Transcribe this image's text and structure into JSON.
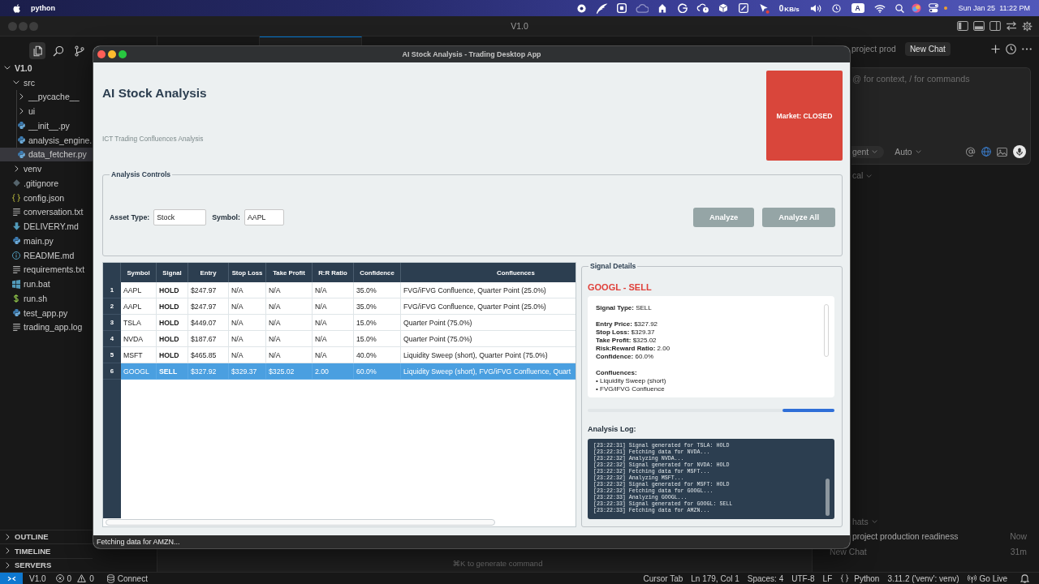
{
  "menu_bar": {
    "app_name": "python",
    "network_speed": "0",
    "network_unit": "KB/s",
    "input_source": "A",
    "date": "Sun Jan 25",
    "time": "11:22 PM"
  },
  "ide": {
    "title": "V1.0",
    "activity_bar": [
      {
        "selected": true
      },
      {
        "selected": false
      },
      {
        "selected": false
      }
    ],
    "editor_tabs": [
      {
        "selected": false
      },
      {
        "selected": true
      }
    ],
    "explorer": {
      "name": "V1.0",
      "expanded": true,
      "children": [
        {
          "name": "src",
          "kind": "folder",
          "expanded": true,
          "selected": false,
          "children": [
            {
              "name": "__pycache__",
              "kind": "folder",
              "expanded": false,
              "selected": false
            },
            {
              "name": "ui",
              "kind": "folder",
              "expanded": false,
              "selected": false
            },
            {
              "name": "__init__.py",
              "kind": "python",
              "selected": false
            },
            {
              "name": "analysis_engine.",
              "kind": "python",
              "selected": false
            },
            {
              "name": "data_fetcher.py",
              "kind": "python",
              "selected": true
            }
          ]
        },
        {
          "name": "venv",
          "kind": "folder",
          "expanded": false,
          "selected": false
        },
        {
          "name": ".gitignore",
          "kind": "git",
          "selected": false
        },
        {
          "name": "config.json",
          "kind": "json",
          "selected": false
        },
        {
          "name": "conversation.txt",
          "kind": "text",
          "selected": false
        },
        {
          "name": "DELIVERY.md",
          "kind": "download",
          "selected": false
        },
        {
          "name": "main.py",
          "kind": "python",
          "selected": false
        },
        {
          "name": "README.md",
          "kind": "info",
          "selected": false
        },
        {
          "name": "requirements.txt",
          "kind": "text",
          "selected": false
        },
        {
          "name": "run.bat",
          "kind": "windows",
          "selected": false
        },
        {
          "name": "run.sh",
          "kind": "shell",
          "selected": false
        },
        {
          "name": "test_app.py",
          "kind": "python",
          "selected": false
        },
        {
          "name": "trading_app.log",
          "kind": "text",
          "selected": false
        }
      ]
    },
    "panels": [
      {
        "label": "OUTLINE",
        "expanded": false
      },
      {
        "label": "TIMELINE",
        "expanded": false
      },
      {
        "label": "SERVERS",
        "expanded": false
      }
    ],
    "editor_hint": "⌘K to generate command",
    "chat": {
      "tabs": [
        {
          "label": "project prod",
          "selected": false
        },
        {
          "label": "New Chat",
          "selected": true
        }
      ],
      "input_placeholder": "@ for context, / for commands",
      "composer_selectors": [
        "gent",
        "Auto"
      ],
      "dropdown": "cal",
      "history_heading": "hats",
      "history": [
        {
          "title": "project production readiness",
          "time": "Now"
        },
        {
          "title": "New Chat",
          "time": "31m"
        }
      ]
    },
    "status_bar": {
      "folder": "V1.0",
      "errors": "0",
      "warnings": "0",
      "connection": "Connect",
      "items": [
        {
          "label": "Cursor Tab",
          "kind": "plain"
        },
        {
          "label": "Ln 179, Col 1",
          "kind": "plain"
        },
        {
          "label": "Spaces: 4",
          "kind": "plain"
        },
        {
          "label": "UTF-8",
          "kind": "plain"
        },
        {
          "label": "LF",
          "kind": "plain"
        },
        {
          "label": "Python",
          "kind": "language"
        },
        {
          "label": "3.11.2 ('venv': venv)",
          "kind": "plain"
        },
        {
          "label": "Go Live",
          "kind": "live"
        }
      ]
    }
  },
  "app": {
    "title": "AI Stock Analysis - Trading Desktop App",
    "header": {
      "title": "AI Stock Analysis",
      "subtitle": "ICT Trading Confluences Analysis",
      "market": {
        "label": "Market: CLOSED",
        "open": false
      }
    },
    "controls": {
      "title": "Analysis Controls",
      "fields": [
        {
          "label": "Asset Type:",
          "value": "Stock"
        },
        {
          "label": "Symbol:",
          "value": "AAPL"
        }
      ],
      "buttons": [
        {
          "label": "Analyze",
          "disabled": true
        },
        {
          "label": "Analyze All",
          "disabled": true
        }
      ]
    },
    "table": {
      "columns": [
        "Symbol",
        "Signal",
        "Entry",
        "Stop Loss",
        "Take Profit",
        "R:R Ratio",
        "Confidence",
        "Confluences"
      ],
      "rows": [
        {
          "number": "1",
          "cells": [
            "AAPL",
            "HOLD",
            "$247.97",
            "N/A",
            "N/A",
            "N/A",
            "35.0%",
            "FVG/iFVG Confluence, Quarter Point (25.0%)"
          ],
          "selected": false
        },
        {
          "number": "2",
          "cells": [
            "AAPL",
            "HOLD",
            "$247.97",
            "N/A",
            "N/A",
            "N/A",
            "35.0%",
            "FVG/iFVG Confluence, Quarter Point (25.0%)"
          ],
          "selected": false
        },
        {
          "number": "3",
          "cells": [
            "TSLA",
            "HOLD",
            "$449.07",
            "N/A",
            "N/A",
            "N/A",
            "15.0%",
            "Quarter Point (75.0%)"
          ],
          "selected": false
        },
        {
          "number": "4",
          "cells": [
            "NVDA",
            "HOLD",
            "$187.67",
            "N/A",
            "N/A",
            "N/A",
            "15.0%",
            "Quarter Point (75.0%)"
          ],
          "selected": false
        },
        {
          "number": "5",
          "cells": [
            "MSFT",
            "HOLD",
            "$465.85",
            "N/A",
            "N/A",
            "N/A",
            "40.0%",
            "Liquidity Sweep (short), Quarter Point (75.0%)"
          ],
          "selected": false
        },
        {
          "number": "6",
          "cells": [
            "GOOGL",
            "SELL",
            "$327.92",
            "$329.37",
            "$325.02",
            "2.00",
            "60.0%",
            "Liquidity Sweep (short), FVG/iFVG Confluence, Quart"
          ],
          "selected": true
        }
      ]
    },
    "details": {
      "title": "Signal Details",
      "heading": "GOOGL - SELL",
      "kind": "sell",
      "sections": [
        {
          "lines": [
            "**Signal Type:** SELL"
          ]
        },
        {
          "lines": [
            "**Entry Price:** $327.92",
            "**Stop Loss:** $329.37",
            "**Take Profit:** $325.02",
            "**Risk:Reward Ratio:** 2.00",
            "**Confidence:** 60.0%"
          ]
        },
        {
          "heading": "Confluences:",
          "lines": [
            "• Liquidity Sweep (short)",
            "• FVG/iFVG Confluence"
          ]
        }
      ],
      "busy": true,
      "log_title": "Analysis Log:",
      "log": [
        "[23:22:31] Signal generated for TSLA: HOLD",
        "[23:22:31] Fetching data for NVDA...",
        "[23:22:32] Analyzing NVDA...",
        "[23:22:32] Signal generated for NVDA: HOLD",
        "[23:22:32] Fetching data for MSFT...",
        "[23:22:32] Analyzing MSFT...",
        "[23:22:32] Signal generated for MSFT: HOLD",
        "[23:22:32] Fetching data for GOOGL...",
        "[23:22:33] Analyzing GOOGL...",
        "[23:22:33] Signal generated for GOOGL: SELL",
        "[23:22:33] Fetching data for AMZN..."
      ]
    },
    "status": "Fetching data for AMZN..."
  }
}
